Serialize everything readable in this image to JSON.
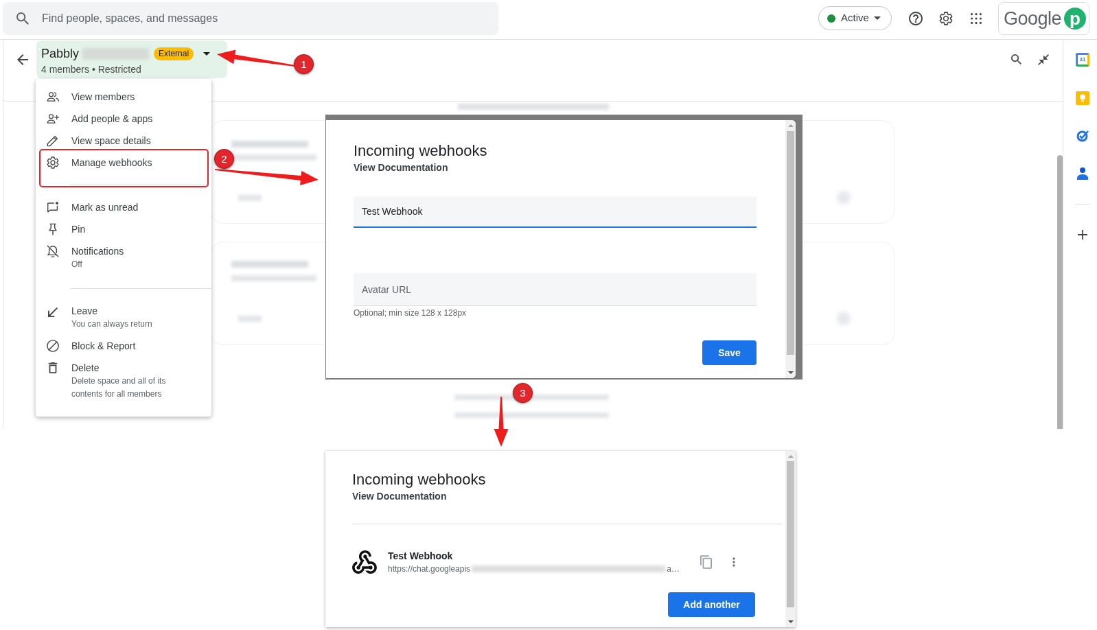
{
  "top_bar": {
    "search": {
      "placeholder": "Find people, spaces, and messages"
    },
    "status": {
      "label": "Active"
    },
    "account": {
      "logo_text": "Google",
      "app_letter": "p"
    }
  },
  "space_header": {
    "name": "Pabbly",
    "badge": "External",
    "subtitle": "4 members • Restricted"
  },
  "menu": {
    "sections": [
      {
        "items": [
          {
            "label": "View members",
            "highlighted": false
          },
          {
            "label": "Add people & apps",
            "highlighted": false
          },
          {
            "label": "View space details",
            "highlighted": false
          },
          {
            "label": "Manage webhooks",
            "highlighted": true
          }
        ]
      },
      {
        "items": [
          {
            "label": "Mark as unread",
            "highlighted": false
          },
          {
            "label": "Pin",
            "highlighted": false
          },
          {
            "label": "Notifications",
            "description": "Off",
            "highlighted": false
          }
        ]
      },
      {
        "items": [
          {
            "label": "Leave",
            "description": "You can always return",
            "highlighted": false
          },
          {
            "label": "Block & Report",
            "highlighted": false
          },
          {
            "label": "Delete",
            "description": "Delete space and all of its contents for all members",
            "highlighted": false
          }
        ]
      }
    ]
  },
  "side_panel": {
    "calendar_day": "31"
  },
  "dialogs": [
    {
      "kind": "form",
      "title": "Incoming webhooks",
      "link": "View Documentation",
      "fields": [
        {
          "value": "Test Webhook",
          "focused": true
        },
        {
          "placeholder": "Avatar URL",
          "hint": "Optional; min size 128 x 128px",
          "focused": false
        }
      ],
      "button": "Save"
    },
    {
      "kind": "list",
      "title": "Incoming webhooks",
      "link": "View Documentation",
      "webhooks": [
        {
          "name": "Test Webhook",
          "url_start": "https://chat.googleapis",
          "url_end": "a…"
        }
      ],
      "button": "Add another"
    }
  ],
  "annotations": [
    {
      "number": "1"
    },
    {
      "number": "2"
    },
    {
      "number": "3"
    }
  ]
}
